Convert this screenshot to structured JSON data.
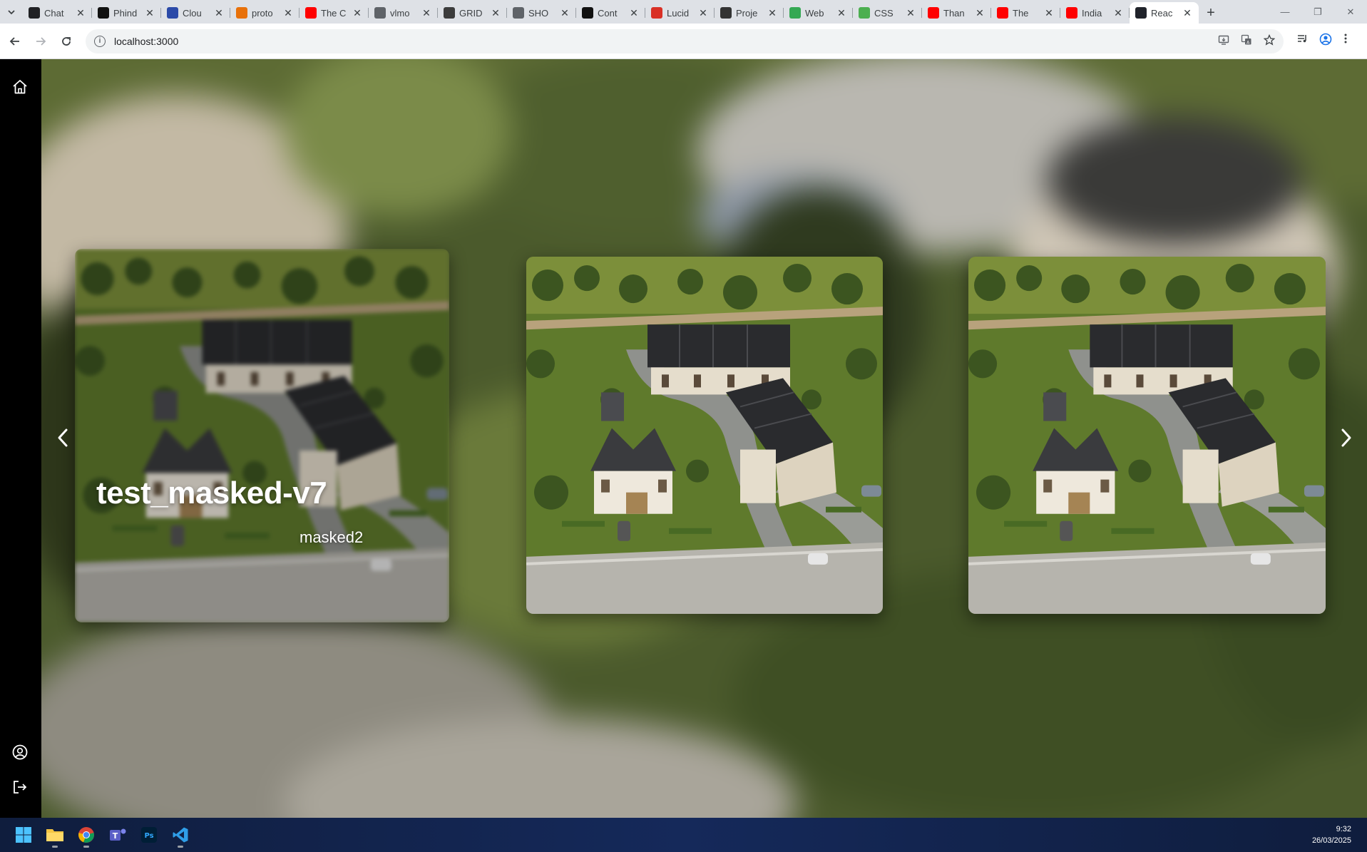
{
  "browser": {
    "tabs": [
      {
        "label": "Chat",
        "favicon": "chatgpt-icon",
        "color": "#202124"
      },
      {
        "label": "Phind",
        "favicon": "phind-icon",
        "color": "#111111"
      },
      {
        "label": "Clou",
        "favicon": "cloud-icon",
        "color": "#2b4aa8"
      },
      {
        "label": "proto",
        "favicon": "flame-icon",
        "color": "#e8710a"
      },
      {
        "label": "The C",
        "favicon": "youtube-icon",
        "color": "#ff0000"
      },
      {
        "label": "vlmo",
        "favicon": "globe-icon",
        "color": "#5f6368"
      },
      {
        "label": "GRID",
        "favicon": "grid-icon",
        "color": "#3c3c3c"
      },
      {
        "label": "SHO",
        "favicon": "globe-icon",
        "color": "#5f6368"
      },
      {
        "label": "Cont",
        "favicon": "terminal-icon",
        "color": "#111111"
      },
      {
        "label": "Lucid",
        "favicon": "lucid-icon",
        "color": "#d93025"
      },
      {
        "label": "Proje",
        "favicon": "vuetify-icon",
        "color": "#333333"
      },
      {
        "label": "Web",
        "favicon": "green-dot-icon",
        "color": "#34a853"
      },
      {
        "label": "CSS",
        "favicon": "w-icon",
        "color": "#4caf50"
      },
      {
        "label": "Than",
        "favicon": "youtube-icon",
        "color": "#ff0000"
      },
      {
        "label": "The",
        "favicon": "youtube-icon",
        "color": "#ff0000"
      },
      {
        "label": "India",
        "favicon": "youtube-icon",
        "color": "#ff0000"
      },
      {
        "label": "Reac",
        "favicon": "react-icon",
        "color": "#20232a",
        "active": true
      }
    ],
    "url": "localhost:3000"
  },
  "sidebar": {
    "items": [
      {
        "name": "home",
        "icon": "home-icon"
      },
      {
        "name": "profile",
        "icon": "user-circle-icon"
      },
      {
        "name": "logout",
        "icon": "logout-icon"
      }
    ]
  },
  "carousel": {
    "cards": [
      {
        "title": "test_masked-v7",
        "subtitle": "masked2",
        "focused": true
      },
      {
        "title": "",
        "subtitle": "",
        "focused": false
      },
      {
        "title": "",
        "subtitle": "",
        "focused": false
      }
    ],
    "prev_icon": "chevron-left-icon",
    "next_icon": "chevron-right-icon"
  },
  "taskbar": {
    "apps": [
      "windows-start-icon",
      "file-explorer-icon",
      "chrome-icon",
      "teams-icon",
      "photoshop-icon",
      "vscode-icon"
    ],
    "time": "9:32",
    "date": "26/03/2025"
  },
  "colors": {
    "sidebar_bg": "#000000",
    "tabstrip_bg": "#dee1e6",
    "taskbar_bg": "#15295a"
  }
}
